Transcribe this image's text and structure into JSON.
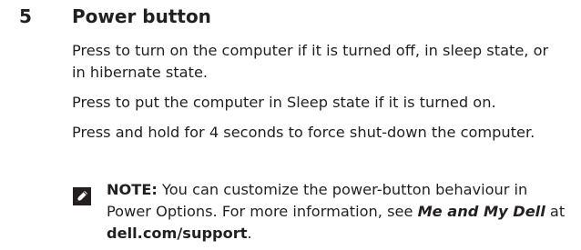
{
  "section": {
    "number": "5",
    "title": "Power button"
  },
  "paragraphs": {
    "p1": "Press to turn on the computer if it is turned off, in sleep state, or in hibernate state.",
    "p2": "Press to put the computer in Sleep state if it is turned on.",
    "p3": "Press and hold for 4 seconds to force shut-down the computer."
  },
  "note": {
    "icon": "pencil-note-icon",
    "label": "NOTE:",
    "text_1": " You can customize the power-button behaviour in Power Options. For more information, see ",
    "doc_title": "Me and My Dell",
    "text_2": " at ",
    "link": "dell.com/support",
    "end": "."
  }
}
